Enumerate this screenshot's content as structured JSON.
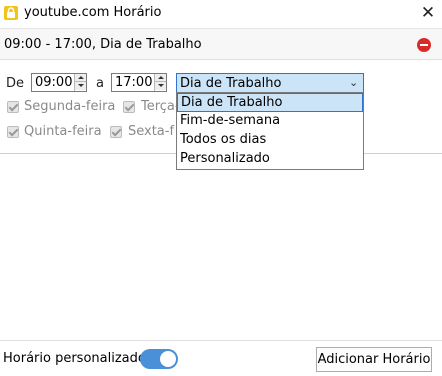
{
  "window": {
    "title": "youtube.com Horário",
    "close_symbol": "✕"
  },
  "schedule": {
    "summary": "09:00 - 17:00, Dia de Trabalho",
    "remove_icon": "remove-icon"
  },
  "editor": {
    "from_label": "De",
    "start_time": "09:00",
    "to_label": "a",
    "end_time": "17:00",
    "period_selected": "Dia de Trabalho",
    "days": [
      {
        "label": "Segunda-feira",
        "checked": true
      },
      {
        "label": "Terça-f",
        "checked": true
      },
      {
        "label": "Quinta-feira",
        "checked": true
      },
      {
        "label": "Sexta-f",
        "checked": true
      }
    ]
  },
  "dropdown": {
    "options": [
      "Dia de Trabalho",
      "Fim-de-semana",
      "Todos os dias",
      "Personalizado"
    ],
    "selected_index": 0
  },
  "footer": {
    "custom_label": "Horário personalizado",
    "toggle_on": true,
    "add_button": "Adicionar Horário"
  },
  "colors": {
    "accent": "#4a90d9",
    "selection": "#cce4f7",
    "remove": "#d92a2a"
  }
}
